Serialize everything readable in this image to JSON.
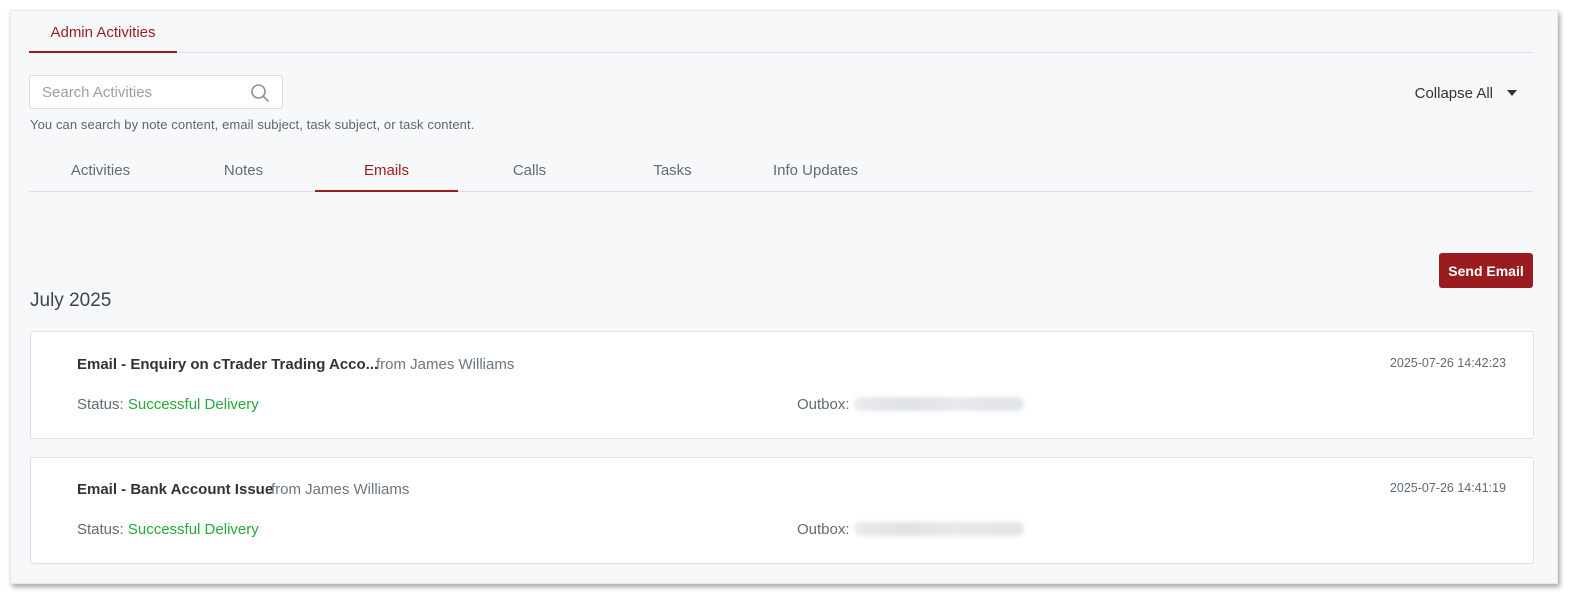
{
  "header": {
    "tab_label": "Admin Activities"
  },
  "search": {
    "placeholder": "Search Activities",
    "value": "",
    "hint": "You can search by note content, email subject, task subject, or task content."
  },
  "collapse": {
    "label": "Collapse All"
  },
  "tabs": [
    {
      "label": "Activities",
      "active": false
    },
    {
      "label": "Notes",
      "active": false
    },
    {
      "label": "Emails",
      "active": true
    },
    {
      "label": "Calls",
      "active": false
    },
    {
      "label": "Tasks",
      "active": false
    },
    {
      "label": "Info Updates",
      "active": false
    }
  ],
  "actions": {
    "send_email_label": "Send Email"
  },
  "group": {
    "month": "July 2025",
    "emails": [
      {
        "title": "Email - Enquiry on cTrader Trading Acco...",
        "from": "from James Williams",
        "timestamp": "2025-07-26 14:42:23",
        "status_label": "Status: ",
        "status_value": "Successful Delivery",
        "outbox_label": "Outbox:"
      },
      {
        "title": "Email - Bank Account Issue",
        "from": "from James Williams",
        "timestamp": "2025-07-26 14:41:19",
        "status_label": "Status: ",
        "status_value": "Successful Delivery",
        "outbox_label": "Outbox:"
      }
    ]
  },
  "colors": {
    "accent": "#9b1c1f",
    "success": "#27a83a"
  }
}
